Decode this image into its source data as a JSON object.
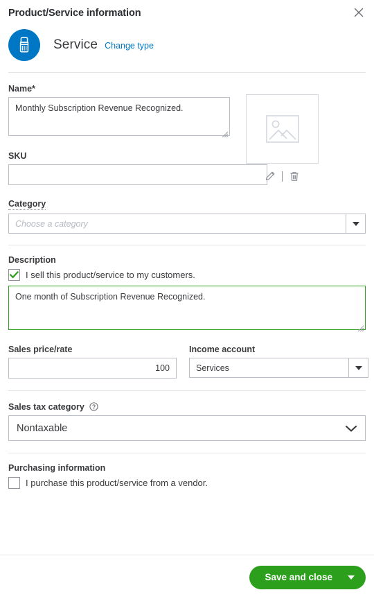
{
  "header": {
    "title": "Product/Service information",
    "close_label": "Close"
  },
  "type_section": {
    "icon": "paintbrush-icon",
    "type_name": "Service",
    "change_type_label": "Change type"
  },
  "name_field": {
    "label": "Name*",
    "value": "Monthly Subscription Revenue Recognized.",
    "placeholder": ""
  },
  "sku_field": {
    "label": "SKU",
    "value": "",
    "placeholder": ""
  },
  "thumbnail": {
    "placeholder_icon": "image-placeholder-icon",
    "edit_icon": "pencil-icon",
    "delete_icon": "trash-icon"
  },
  "category_field": {
    "label": "Category",
    "value": "",
    "placeholder": "Choose a category"
  },
  "description_section": {
    "title": "Description",
    "sell_checkbox_label": "I sell this product/service to my customers.",
    "sell_checkbox_checked": true,
    "description_value": "One month of Subscription Revenue Recognized.",
    "description_placeholder": ""
  },
  "sales_price_field": {
    "label": "Sales price/rate",
    "value": "100",
    "placeholder": ""
  },
  "income_account_field": {
    "label": "Income account",
    "value": "Services",
    "placeholder": ""
  },
  "sales_tax_field": {
    "label": "Sales tax category",
    "help_icon": "question-circle-icon",
    "value": "Nontaxable"
  },
  "purchasing_section": {
    "title": "Purchasing information",
    "purchase_checkbox_label": "I purchase this product/service from a vendor.",
    "purchase_checkbox_checked": false
  },
  "footer": {
    "save_label": "Save and close",
    "caret_icon": "caret-down-icon"
  },
  "colors": {
    "brand_blue": "#0077c5",
    "brand_green": "#2ca01c",
    "link_blue": "#0077c5",
    "border_gray": "#babec5",
    "divider_gray": "#e3e5e8",
    "text_dark": "#393a3d",
    "placeholder_gray": "#b7bbc2"
  }
}
